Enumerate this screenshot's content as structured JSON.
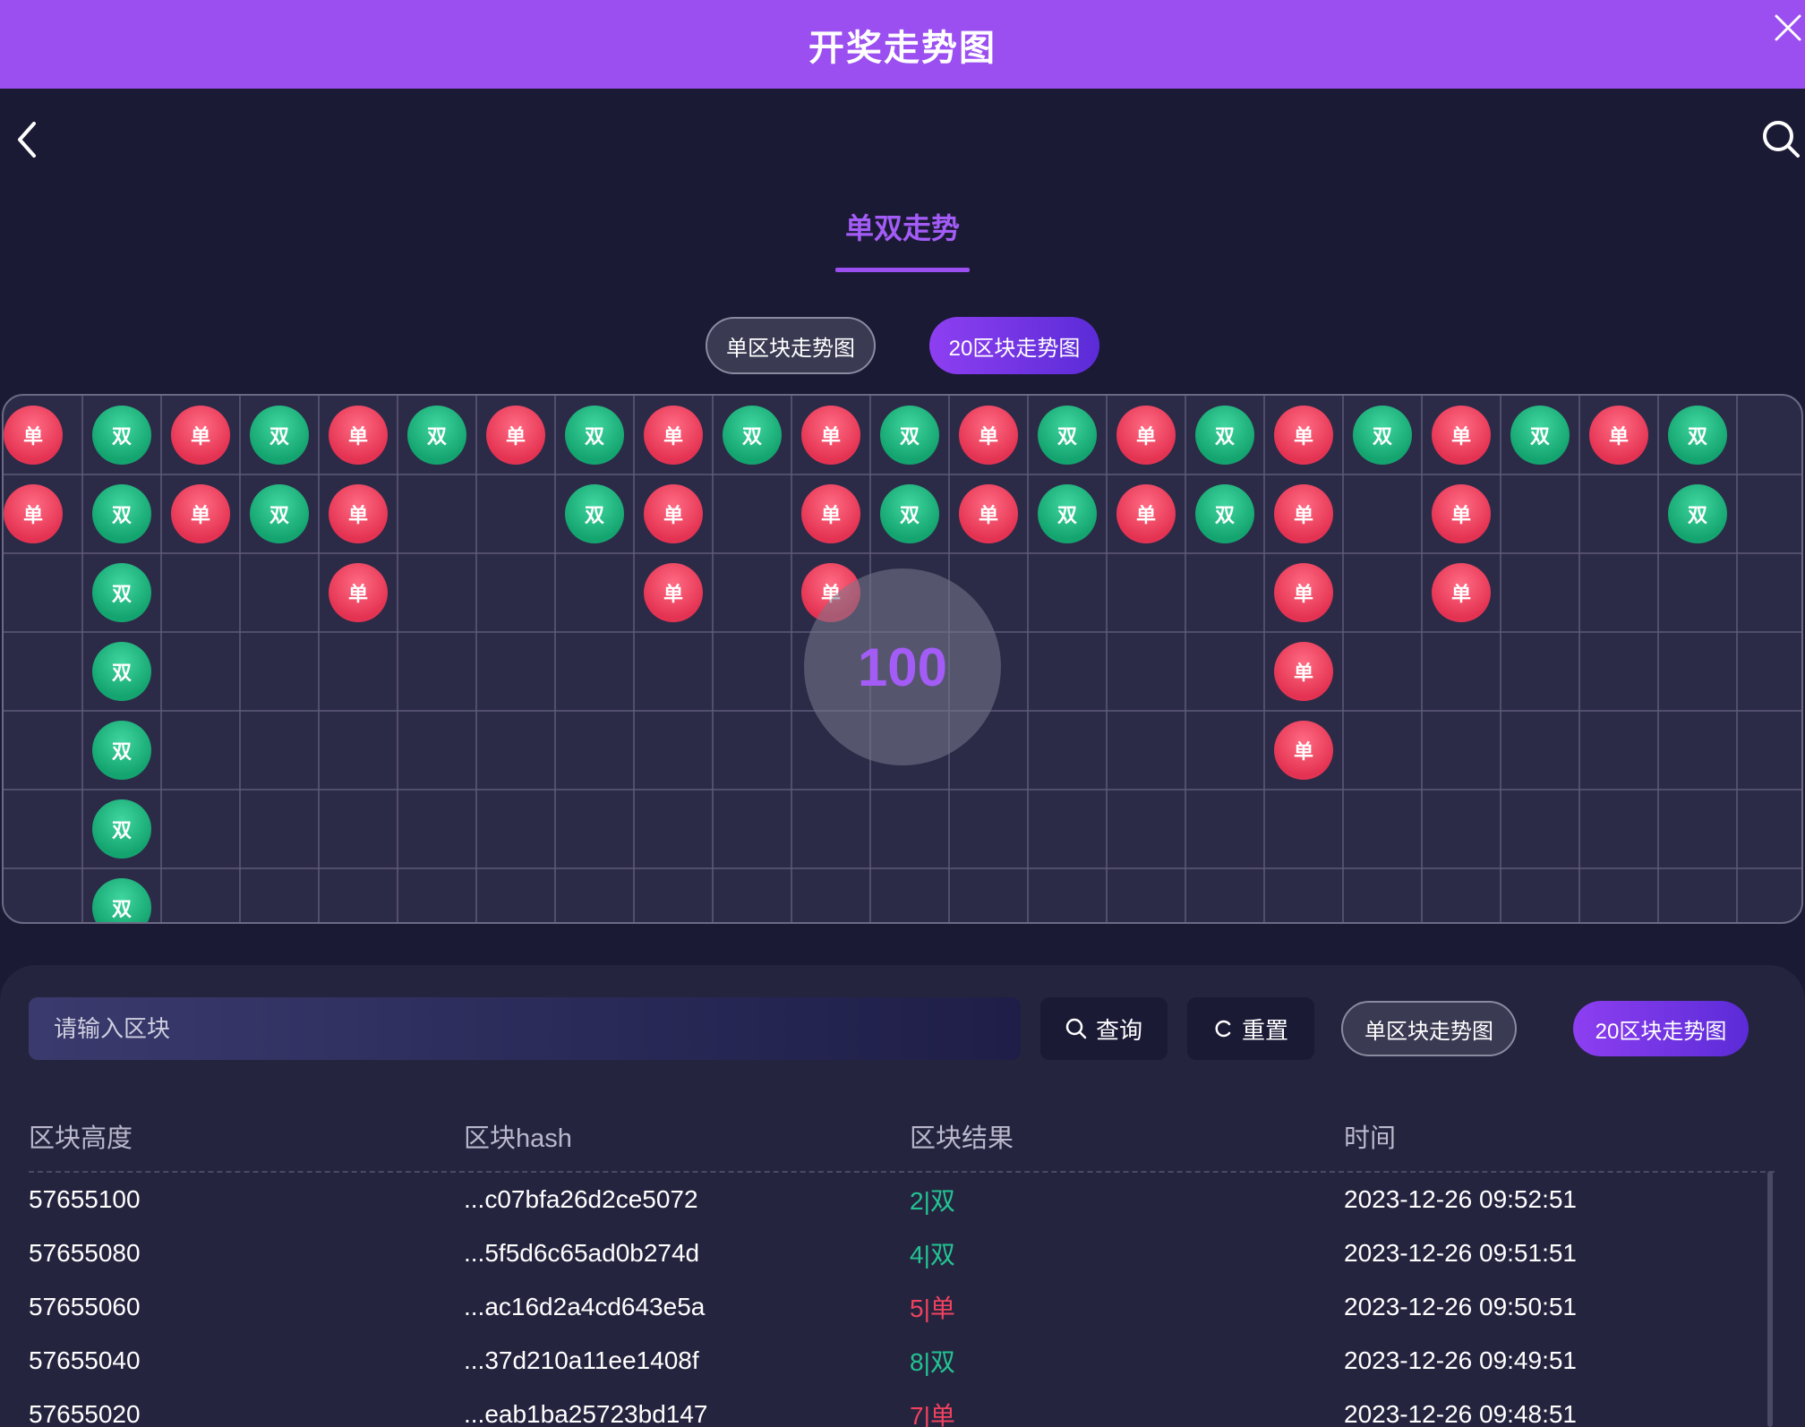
{
  "window": {
    "title": "开奖走势图"
  },
  "tab": {
    "label": "单双走势"
  },
  "toggles": {
    "single_label": "单区块走势图",
    "twenty_label": "20区块走势图"
  },
  "grid": {
    "columns": [
      [
        "单",
        "单"
      ],
      [
        "双",
        "双",
        "双",
        "双",
        "双",
        "双",
        "双"
      ],
      [
        "单",
        "单"
      ],
      [
        "双",
        "双"
      ],
      [
        "单",
        "单",
        "单"
      ],
      [
        "双"
      ],
      [
        "单"
      ],
      [
        "双",
        "双"
      ],
      [
        "单",
        "单",
        "单"
      ],
      [
        "双"
      ],
      [
        "单",
        "单",
        "单"
      ],
      [
        "双",
        "双"
      ],
      [
        "单",
        "单"
      ],
      [
        "双",
        "双"
      ],
      [
        "单",
        "单"
      ],
      [
        "双",
        "双"
      ],
      [
        "单",
        "单",
        "单",
        "单",
        "单"
      ],
      [
        "双"
      ],
      [
        "单",
        "单",
        "单"
      ],
      [
        "双"
      ],
      [
        "单"
      ],
      [
        "双",
        "双"
      ]
    ],
    "overlay_count": "100"
  },
  "search": {
    "placeholder": "请输入区块",
    "query_label": "查询",
    "reset_label": "重置"
  },
  "table": {
    "headers": [
      "区块高度",
      "区块hash",
      "区块结果",
      "时间"
    ],
    "rows": [
      {
        "height": "57655100",
        "hash": "...c07bfa26d2ce5072",
        "result": "2|双",
        "type": "shuang",
        "time": "2023-12-26 09:52:51"
      },
      {
        "height": "57655080",
        "hash": "...5f5d6c65ad0b274d",
        "result": "4|双",
        "type": "shuang",
        "time": "2023-12-26 09:51:51"
      },
      {
        "height": "57655060",
        "hash": "...ac16d2a4cd643e5a",
        "result": "5|单",
        "type": "dan",
        "time": "2023-12-26 09:50:51"
      },
      {
        "height": "57655040",
        "hash": "...37d210a11ee1408f",
        "result": "8|双",
        "type": "shuang",
        "time": "2023-12-26 09:49:51"
      },
      {
        "height": "57655020",
        "hash": "...eab1ba25723bd147",
        "result": "7|单",
        "type": "dan",
        "time": "2023-12-26 09:48:51"
      }
    ]
  },
  "colors": {
    "accent": "#9b4ff0",
    "dan": "#e43352",
    "shuang": "#14a46f"
  }
}
